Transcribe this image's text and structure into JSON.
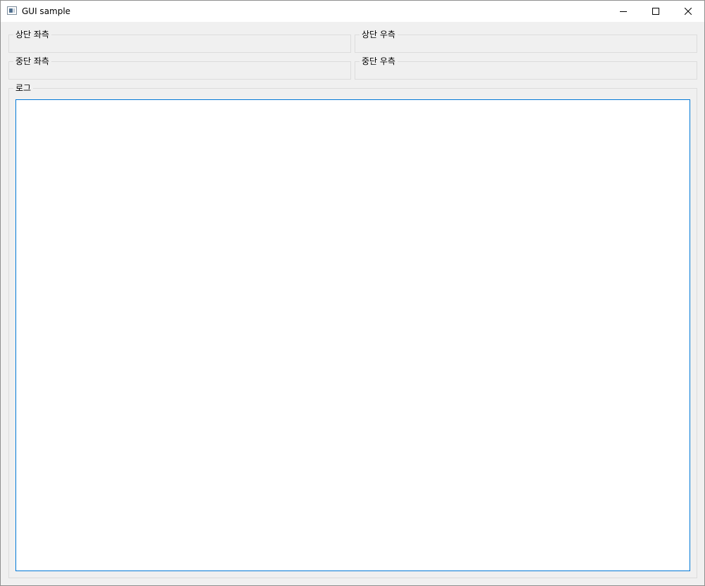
{
  "window": {
    "title": "GUI sample",
    "icon": "app-window-icon",
    "controls": [
      "minimize-icon",
      "maximize-icon",
      "close-icon"
    ]
  },
  "groups": {
    "top_left": "상단 좌측",
    "top_right": "상단 우측",
    "mid_left": "중단 좌측",
    "mid_right": "중단 우측",
    "log": "로그"
  },
  "log": {
    "text": ""
  },
  "colors": {
    "window_bg": "#f0f0f0",
    "titlebar_bg": "#ffffff",
    "focus_border": "#0078d7",
    "group_border": "#dcdcdc"
  }
}
